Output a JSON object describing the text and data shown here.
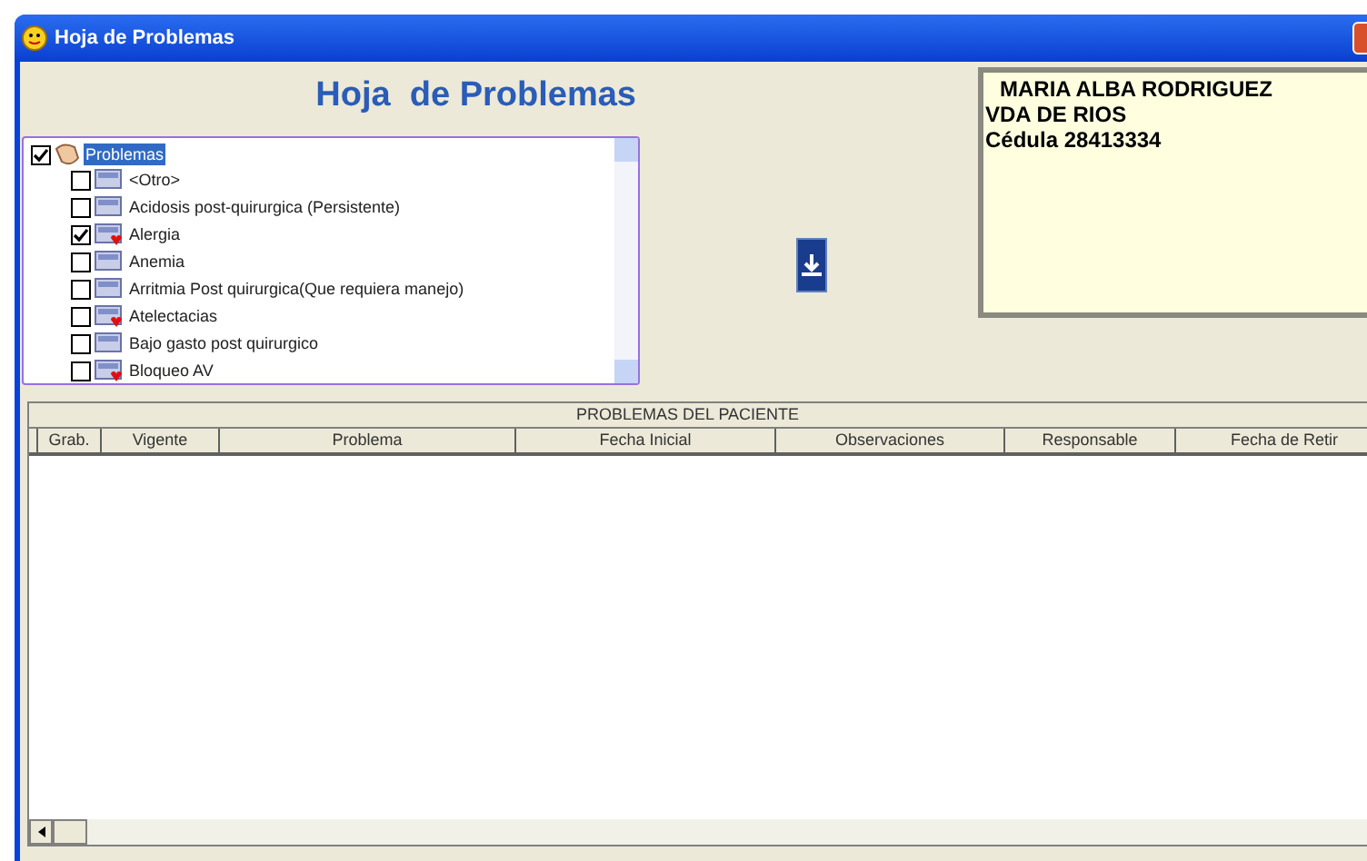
{
  "window": {
    "title": "Hoja de Problemas"
  },
  "heading": "Hoja  de Problemas",
  "tree": {
    "label": "Problemas",
    "checked": true,
    "selected": true,
    "children": [
      {
        "label": "<Otro>",
        "checked": false,
        "kind": "plain"
      },
      {
        "label": "Acidosis post-quirurgica (Persistente)",
        "checked": false,
        "kind": "plain"
      },
      {
        "label": "Alergia",
        "checked": true,
        "kind": "flagged"
      },
      {
        "label": "Anemia",
        "checked": false,
        "kind": "plain"
      },
      {
        "label": "Arritmia Post quirurgica(Que requiera manejo)",
        "checked": false,
        "kind": "plain"
      },
      {
        "label": "Atelectacias",
        "checked": false,
        "kind": "flagged"
      },
      {
        "label": "Bajo gasto post quirurgico",
        "checked": false,
        "kind": "plain"
      },
      {
        "label": "Bloqueo AV",
        "checked": false,
        "kind": "flagged"
      }
    ]
  },
  "patient": {
    "lines": [
      "MARIA ALBA RODRIGUEZ",
      "VDA DE RIOS",
      "Cédula 28413334"
    ]
  },
  "grid": {
    "title": "PROBLEMAS DEL PACIENTE",
    "columns": [
      "Grab.",
      "Vigente",
      "Problema",
      "Fecha Inicial",
      "Observaciones",
      "Responsable",
      "Fecha de Retir"
    ]
  }
}
